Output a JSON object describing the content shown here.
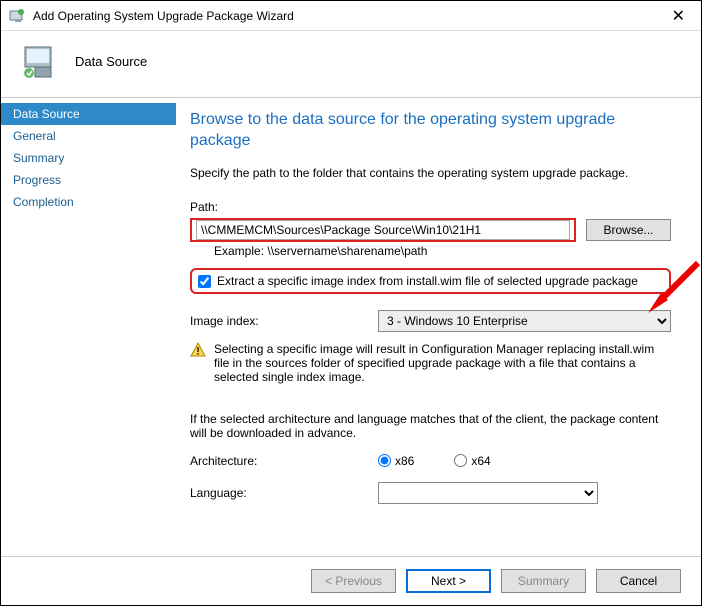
{
  "window": {
    "title": "Add Operating System Upgrade Package Wizard"
  },
  "header": {
    "heading": "Data Source"
  },
  "sidebar": {
    "items": [
      {
        "label": "Data Source"
      },
      {
        "label": "General"
      },
      {
        "label": "Summary"
      },
      {
        "label": "Progress"
      },
      {
        "label": "Completion"
      }
    ]
  },
  "main": {
    "title": "Browse to the data source for the operating system upgrade package",
    "instruction": "Specify the path to the folder that contains the operating system upgrade package.",
    "path_label": "Path:",
    "path_value": "\\\\CMMEMCM\\Sources\\Package Source\\Win10\\21H1",
    "browse_label": "Browse...",
    "example": "Example: \\\\servername\\sharename\\path",
    "extract_label": "Extract a specific image index from install.wim file of selected upgrade package",
    "extract_checked": true,
    "image_index_label": "Image index:",
    "image_index_value": "3 - Windows 10 Enterprise",
    "warning": "Selecting a specific image will result in Configuration Manager replacing install.wim file in the sources folder of specified upgrade package with a file that contains a selected single index image.",
    "advance_note": "If the selected architecture and language matches that of the client, the package content will be downloaded in advance.",
    "architecture_label": "Architecture:",
    "arch_x86": "x86",
    "arch_x64": "x64",
    "language_label": "Language:",
    "language_value": ""
  },
  "footer": {
    "previous": "< Previous",
    "next": "Next >",
    "summary": "Summary",
    "cancel": "Cancel"
  }
}
